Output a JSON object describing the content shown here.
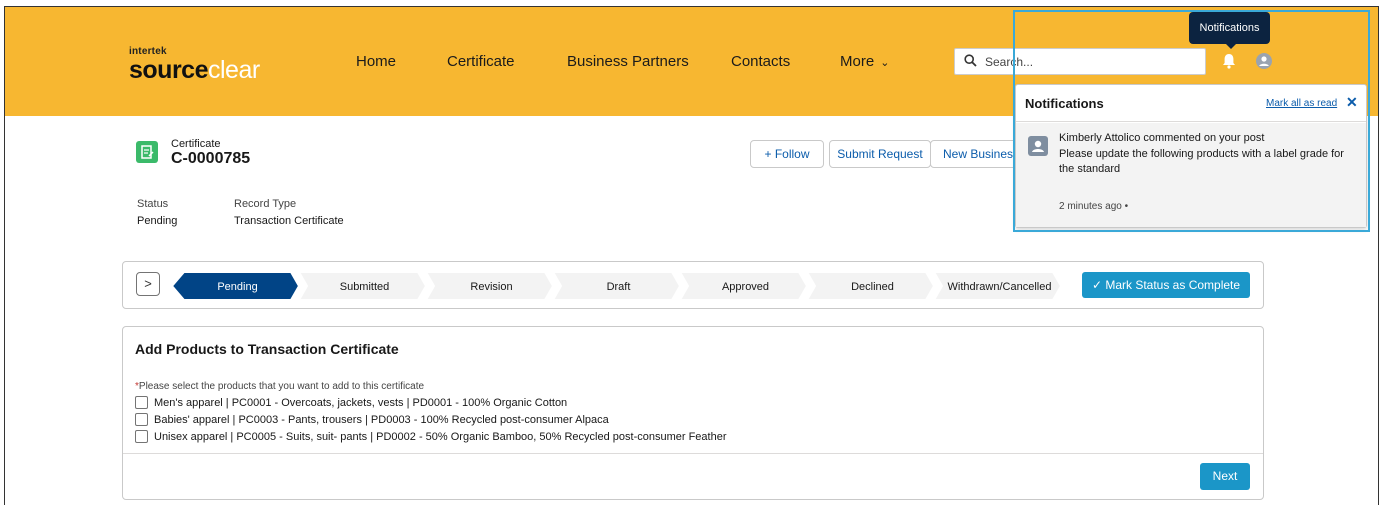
{
  "header": {
    "logo_small": "intertek",
    "logo_word1": "source",
    "logo_word2": "clear",
    "nav": [
      {
        "label": "Home"
      },
      {
        "label": "Certificate"
      },
      {
        "label": "Business Partners"
      },
      {
        "label": "Contacts"
      },
      {
        "label": "More"
      }
    ],
    "search_placeholder": "Search...",
    "tooltip": "Notifications"
  },
  "record": {
    "object_label": "Certificate",
    "name": "C-0000785",
    "buttons": {
      "follow": "+ Follow",
      "submit_request": "Submit Request",
      "new_business": "New Business"
    },
    "fields": [
      {
        "label": "Status",
        "value": "Pending"
      },
      {
        "label": "Record Type",
        "value": "Transaction Certificate"
      }
    ]
  },
  "path": {
    "toggle": ">",
    "stages": [
      "Pending",
      "Submitted",
      "Revision",
      "Draft",
      "Approved",
      "Declined",
      "Withdrawn/Cancelled"
    ],
    "active_index": 0,
    "mark_button": "✓  Mark Status as Complete",
    "active_color": "#014486"
  },
  "products": {
    "title": "Add Products to Transaction Certificate",
    "hint_required": "*",
    "hint": "Please select the products that you want to add to this certificate",
    "items": [
      {
        "label": "Men's apparel | PC0001 - Overcoats, jackets, vests | PD0001 - 100% Organic Cotton"
      },
      {
        "label": "Babies' apparel | PC0003 - Pants, trousers | PD0003 - 100% Recycled post-consumer Alpaca"
      },
      {
        "label": "Unisex apparel | PC0005 - Suits, suit- pants | PD0002 - 50% Organic Bamboo, 50% Recycled post-consumer Feather"
      }
    ],
    "next": "Next"
  },
  "notifications": {
    "title": "Notifications",
    "mark_all": "Mark all as read",
    "close": "✕",
    "item": {
      "line1": "Kimberly Attolico commented on your post",
      "line2": "Please update the following products with a label grade for the standard",
      "time": "2 minutes ago •"
    }
  },
  "colors": {
    "header_bg": "#f7b731",
    "brand_blue": "#1b96c8",
    "path_active": "#014486",
    "highlight": "#3aa9d8"
  }
}
